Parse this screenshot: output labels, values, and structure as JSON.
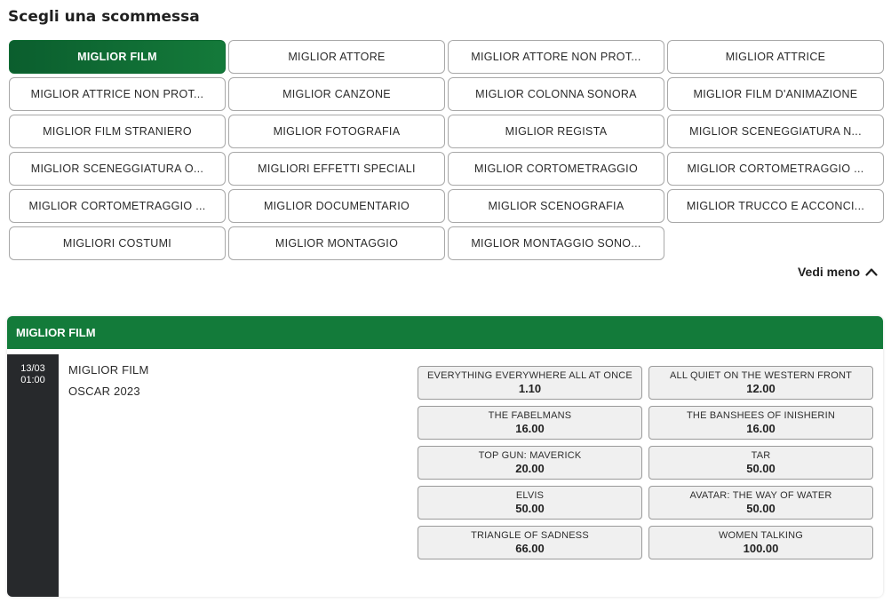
{
  "title": "Scegli una scommessa",
  "bet_types": [
    {
      "label": "MIGLIOR FILM",
      "active": true
    },
    {
      "label": "MIGLIOR ATTORE"
    },
    {
      "label": "MIGLIOR ATTORE NON PROT..."
    },
    {
      "label": "MIGLIOR ATTRICE"
    },
    {
      "label": "MIGLIOR ATTRICE NON PROT..."
    },
    {
      "label": "MIGLIOR CANZONE"
    },
    {
      "label": "MIGLIOR COLONNA SONORA"
    },
    {
      "label": "MIGLIOR FILM D'ANIMAZIONE"
    },
    {
      "label": "MIGLIOR FILM STRANIERO"
    },
    {
      "label": "MIGLIOR FOTOGRAFIA"
    },
    {
      "label": "MIGLIOR REGISTA"
    },
    {
      "label": "MIGLIOR SCENEGGIATURA N..."
    },
    {
      "label": "MIGLIOR SCENEGGIATURA O..."
    },
    {
      "label": "MIGLIORI EFFETTI SPECIALI"
    },
    {
      "label": "MIGLIOR CORTOMETRAGGIO"
    },
    {
      "label": "MIGLIOR CORTOMETRAGGIO ..."
    },
    {
      "label": "MIGLIOR CORTOMETRAGGIO ..."
    },
    {
      "label": "MIGLIOR DOCUMENTARIO"
    },
    {
      "label": "MIGLIOR SCENOGRAFIA"
    },
    {
      "label": "MIGLIOR TRUCCO E ACCONCI..."
    },
    {
      "label": "MIGLIORI COSTUMI"
    },
    {
      "label": "MIGLIOR MONTAGGIO"
    },
    {
      "label": "MIGLIOR MONTAGGIO SONO..."
    }
  ],
  "toggle": {
    "label": "Vedi meno",
    "icon": "chevron-up-icon"
  },
  "market": {
    "header": "MIGLIOR FILM",
    "event": {
      "date": "13/03",
      "time": "01:00",
      "name": "MIGLIOR FILM",
      "competition": "OSCAR 2023"
    },
    "odds": [
      {
        "label": "EVERYTHING EVERYWHERE ALL AT ONCE",
        "value": "1.10"
      },
      {
        "label": "ALL QUIET ON THE WESTERN FRONT",
        "value": "12.00"
      },
      {
        "label": "THE FABELMANS",
        "value": "16.00"
      },
      {
        "label": "THE BANSHEES OF INISHERIN",
        "value": "16.00"
      },
      {
        "label": "TOP GUN: MAVERICK",
        "value": "20.00"
      },
      {
        "label": "TAR",
        "value": "50.00"
      },
      {
        "label": "ELVIS",
        "value": "50.00"
      },
      {
        "label": "AVATAR: THE WAY OF WATER",
        "value": "50.00"
      },
      {
        "label": "TRIANGLE OF SADNESS",
        "value": "66.00"
      },
      {
        "label": "WOMEN TALKING",
        "value": "100.00"
      }
    ]
  },
  "colors": {
    "accent": "#137b3a",
    "date_bg": "#27292c"
  }
}
